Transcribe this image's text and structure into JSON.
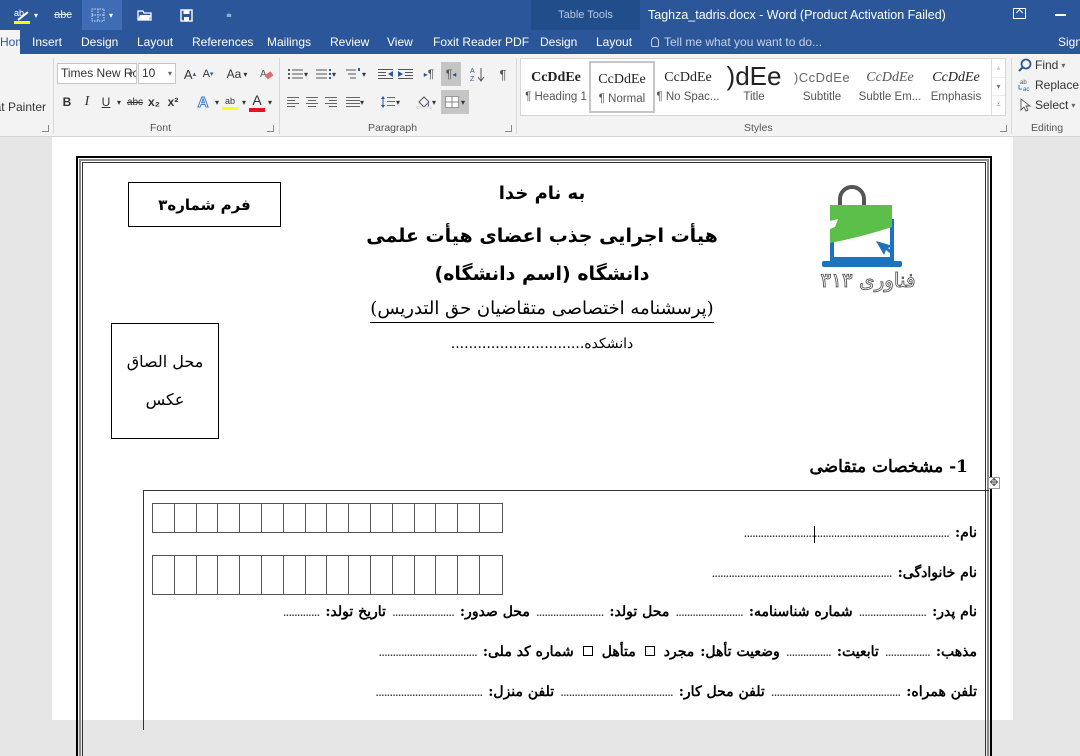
{
  "qat": {
    "spell_icon": "spelling-highlight-icon",
    "strike_label": "abc",
    "borders_icon": "table-borders-icon",
    "open_icon": "open-folder-icon",
    "save_icon": "save-icon",
    "customize_icon": "customize-qat-icon"
  },
  "window": {
    "context_group": "Table Tools",
    "title": "Taghza_tadris.docx - Word (Product Activation Failed)"
  },
  "tabs": {
    "home": "Home",
    "items": [
      "Insert",
      "Design",
      "Layout",
      "References",
      "Mailings",
      "Review",
      "View",
      "Foxit Reader PDF"
    ],
    "context_items": [
      "Design",
      "Layout"
    ],
    "tell_me_placeholder": "Tell me what you want to do...",
    "sign_in": "Sign in"
  },
  "ribbon": {
    "clipboard": {
      "format_painter": "Format Painter"
    },
    "font": {
      "group_label": "Font",
      "font_name": "Times New Roman",
      "font_name_display": "Times New Rc",
      "font_size": "10",
      "grow": "A",
      "shrink": "A",
      "change_case": "Aa",
      "bold": "B",
      "italic": "I",
      "underline": "U",
      "strikethrough": "abc",
      "subscript": "x₂",
      "superscript": "x²",
      "text_effects": "A",
      "highlight": "ab",
      "font_color": "A",
      "highlight_color": "#ffff00",
      "font_color_value": "#e81123"
    },
    "paragraph": {
      "group_label": "Paragraph",
      "pilcrow": "¶",
      "ltr": "¶",
      "rtl": "¶"
    },
    "styles": {
      "group_label": "Styles",
      "items": [
        {
          "preview": "CcDdEe",
          "name": "¶ Heading 1"
        },
        {
          "preview": "CcDdEe",
          "name": "¶ Normal",
          "selected": true
        },
        {
          "preview": "CcDdEe",
          "name": "¶ No Spac..."
        },
        {
          "preview": ")dEe",
          "name": "Title"
        },
        {
          "preview": ")CcDdEe",
          "name": "Subtitle"
        },
        {
          "preview": "CcDdEe",
          "name": "Subtle Em..."
        },
        {
          "preview": "CcDdEe",
          "name": "Emphasis"
        }
      ]
    },
    "editing": {
      "group_label": "Editing",
      "find": "Find",
      "replace": "Replace",
      "select": "Select"
    }
  },
  "document": {
    "form_number": "فرم شماره۳",
    "basmala": "به نام خدا",
    "board": "هیأت اجرایی جذب اعضای هیأت علمی",
    "university": "دانشگاه (اسم دانشگاه)",
    "subtitle": "(پرسشنامه اختصاصی متقاضیان حق التدریس)",
    "faculty": "دانشکده..............................",
    "photo_line1": "محل الصاق",
    "photo_line2": "عکس",
    "logo_text": "فناوری ۳۱۳",
    "logo_colors": {
      "green": "#5bbf4a",
      "blue": "#1e73be",
      "handle": "#555555"
    },
    "section_title": "1-  مشخصات متقاضی",
    "digit_boxes_per_row": 16,
    "fields": {
      "first_name": {
        "label": "نام:",
        "dots": "........................................................................."
      },
      "last_name": {
        "label": "نام خانوادگی:",
        "dots": "................................................................"
      },
      "father_name": {
        "label": "نام پدر:",
        "dots": "........................"
      },
      "id_number": {
        "label": "شماره شناسنامه:",
        "dots": "........................"
      },
      "birth_place": {
        "label": "محل تولد:",
        "dots": "........................"
      },
      "issue_place": {
        "label": "محل صدور:",
        "dots": "......................"
      },
      "birth_date": {
        "label": "تاریخ تولد:",
        "dots": "............."
      },
      "religion": {
        "label": "مذهب:",
        "dots": "................"
      },
      "nationality": {
        "label": "تابعیت:",
        "dots": "................"
      },
      "marital_status": {
        "label": "وضعیت تأهل:",
        "single": "مجرد",
        "married": "متأهل"
      },
      "national_id": {
        "label": "شماره کد ملی:",
        "dots": "..................................."
      },
      "mobile": {
        "label": "تلفن همراه:",
        "dots": ".............................................."
      },
      "work_phone": {
        "label": "تلفن محل کار:",
        "dots": "........................................"
      },
      "home_phone": {
        "label": "تلفن منزل:",
        "dots": "......................................"
      }
    }
  }
}
